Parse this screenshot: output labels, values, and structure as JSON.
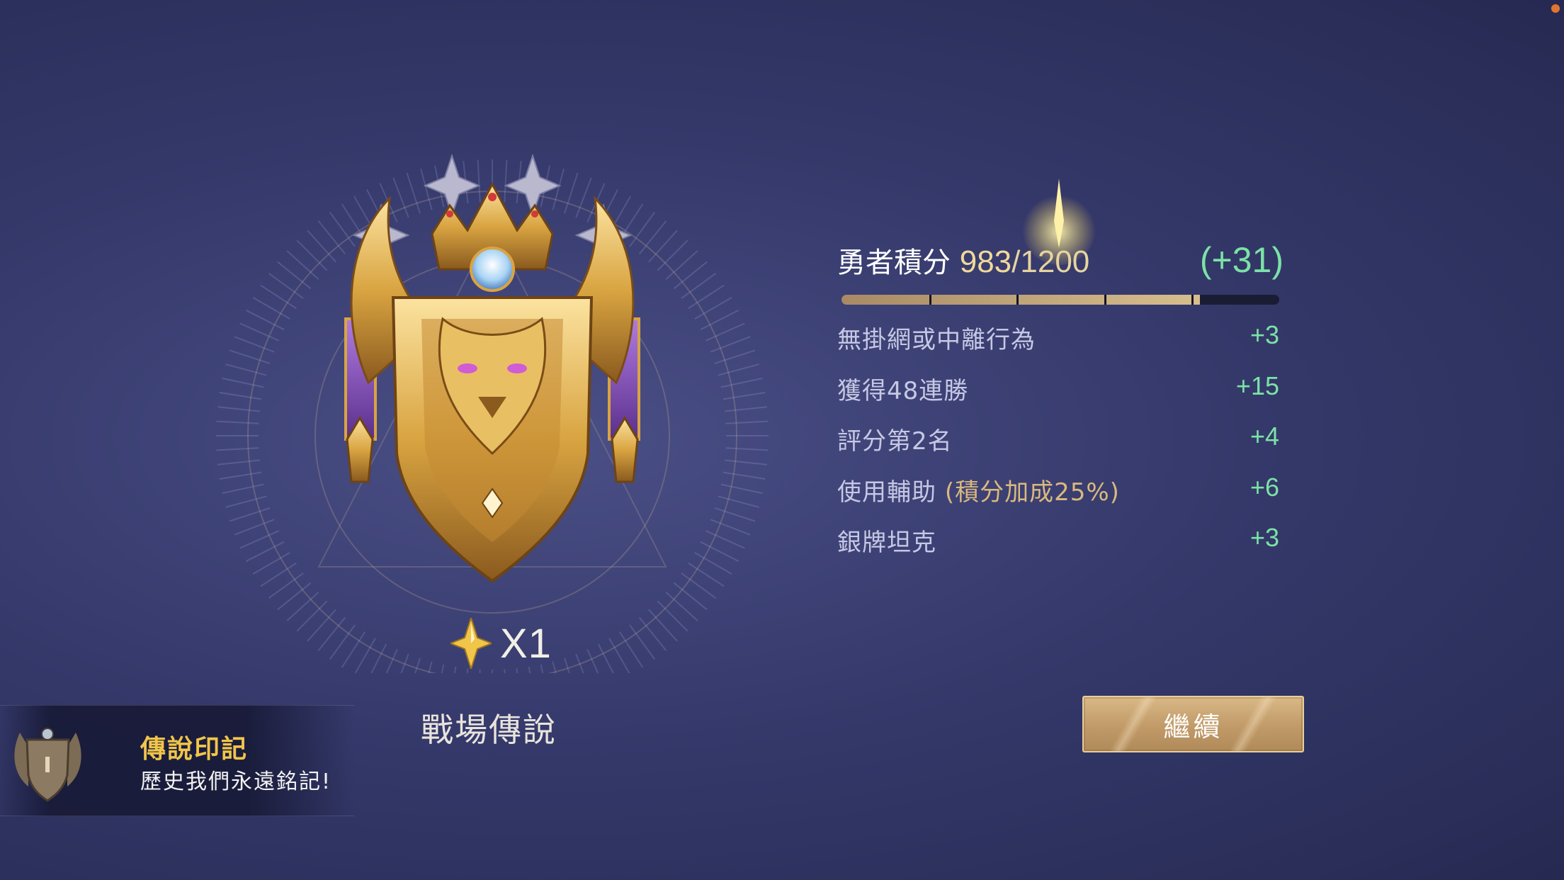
{
  "rank": {
    "name": "戰場傳說",
    "star_multiplier": "X1",
    "star_icon": "gold-star-gem-icon",
    "emblem_icon": "legend-lion-crest-icon",
    "tier_stars_count": 4
  },
  "legend_mark": {
    "title": "傳說印記",
    "subtitle": "歷史我們永遠銘記!"
  },
  "score": {
    "label": "勇者積分",
    "current": "983",
    "separator": "/",
    "max": "1200",
    "gain": "(+31)",
    "progress_fraction": 0.819
  },
  "breakdown": [
    {
      "label": "無掛網或中離行為",
      "value": "+3"
    },
    {
      "label": "獲得48連勝",
      "value": "+15"
    },
    {
      "label": "評分第2名",
      "value": "+4"
    },
    {
      "label": "使用輔助",
      "label_extra": "(積分加成25%)",
      "value": "+6"
    },
    {
      "label": "銀牌坦克",
      "value": "+3"
    }
  ],
  "continue_button": {
    "label": "繼續"
  },
  "colors": {
    "accent_green": "#7be2a6",
    "gold": "#f0c54a",
    "button_gold": "#c19a68"
  }
}
